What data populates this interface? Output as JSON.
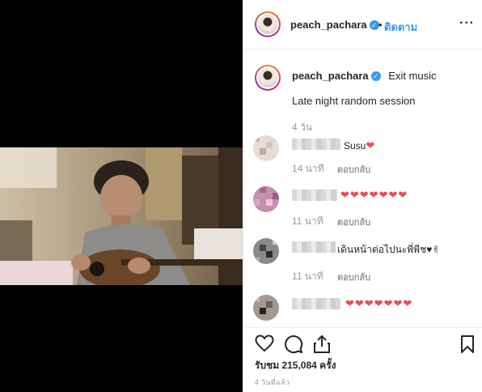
{
  "header": {
    "username": "peach_pachara",
    "separator": "•",
    "follow_label": "ติดตาม",
    "more_label": "···"
  },
  "caption": {
    "username": "peach_pachara",
    "audio": "Exit music",
    "text": "Late night random session",
    "time": "4 วัน"
  },
  "comments": [
    {
      "text": "Susu",
      "hearts": "❤",
      "time": "14 นาที",
      "reply": "ตอบกลับ"
    },
    {
      "text": "",
      "hearts": "❤❤❤❤❤❤❤",
      "time": "11 นาที",
      "reply": "ตอบกลับ"
    },
    {
      "text": "เดินหน้าต่อไปนะพี่พีช",
      "hearts": "♥✌",
      "time": "11 นาที",
      "reply": "ตอบกลับ"
    },
    {
      "text": "",
      "hearts": "❤❤❤❤❤❤❤",
      "time": "",
      "reply": ""
    }
  ],
  "footer": {
    "views": "รับชม 215,084 ครั้ง",
    "posted": "4 วันที่แล้ว"
  },
  "icons": {
    "like": "heart-outline-icon",
    "comment": "speech-bubble-icon",
    "share": "share-upload-icon",
    "save": "bookmark-icon"
  },
  "colors": {
    "accent": "#3897f0",
    "heart": "#ed4956",
    "muted": "#999999"
  }
}
